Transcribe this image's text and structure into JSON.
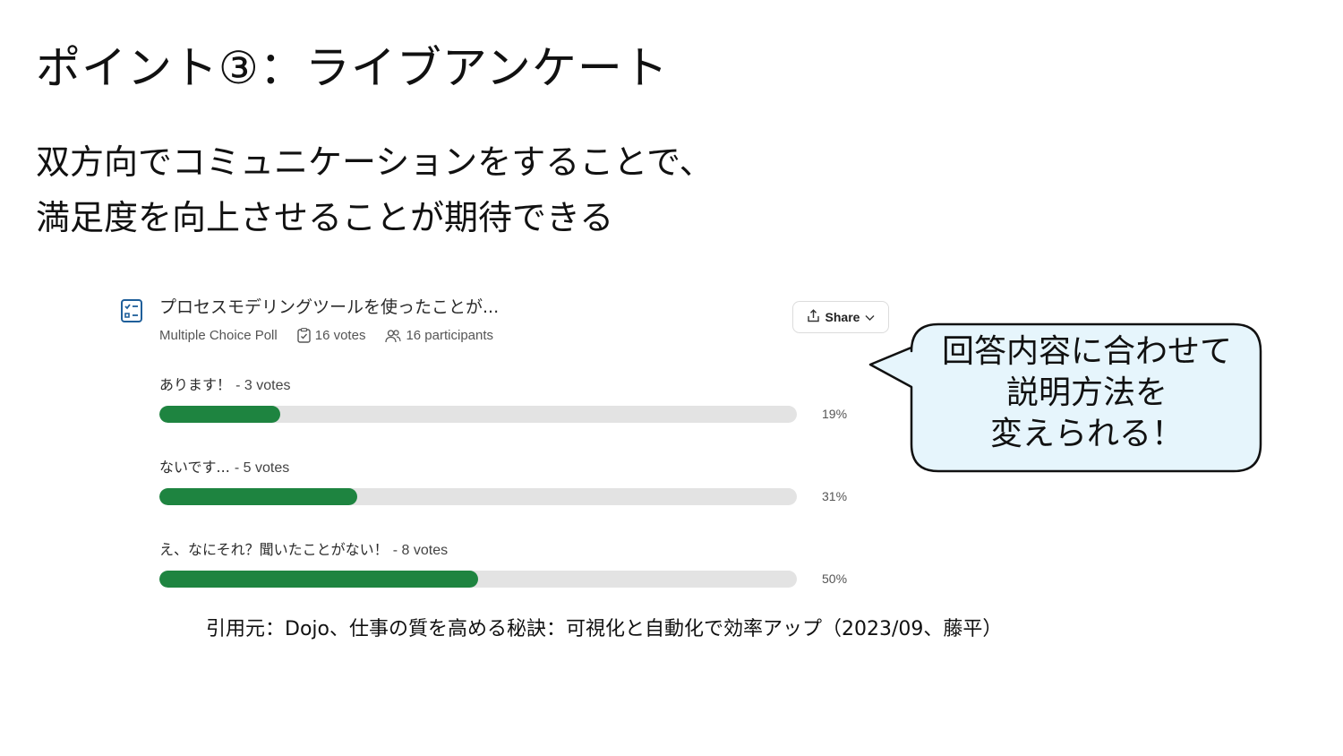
{
  "slide": {
    "title": "ポイント③：ライブアンケート",
    "subtitle_lines": [
      "双方向でコミュニケーションをすることで、",
      "満足度を向上させることが期待できる"
    ],
    "citation": "引用元：Dojo、仕事の質を高める秘訣：可視化と自動化で効率アップ（2023/09、藤平）"
  },
  "poll": {
    "icon": "checklist-icon",
    "title": "プロセスモデリングツールを使ったことが...",
    "type_label": "Multiple Choice Poll",
    "votes_label": "16 votes",
    "participants_label": "16 participants",
    "share_label": "Share",
    "colors": {
      "bar_fill": "#1e8440",
      "bar_track": "#e3e3e3",
      "icon": "#1f5f9a"
    },
    "options": [
      {
        "label": "あります！",
        "votes": "- 3 votes",
        "percent_label": "19%",
        "percent": 19
      },
      {
        "label": "ないです...",
        "votes": "- 5 votes",
        "percent_label": "31%",
        "percent": 31
      },
      {
        "label": "え、なにそれ？聞いたことがない！",
        "votes": "- 8 votes",
        "percent_label": "50%",
        "percent": 50
      }
    ]
  },
  "callout": {
    "lines": [
      "回答内容に合わせて",
      "説明方法を",
      "変えられる！"
    ],
    "colors": {
      "fill": "#e6f5fc",
      "stroke": "#111111"
    }
  }
}
